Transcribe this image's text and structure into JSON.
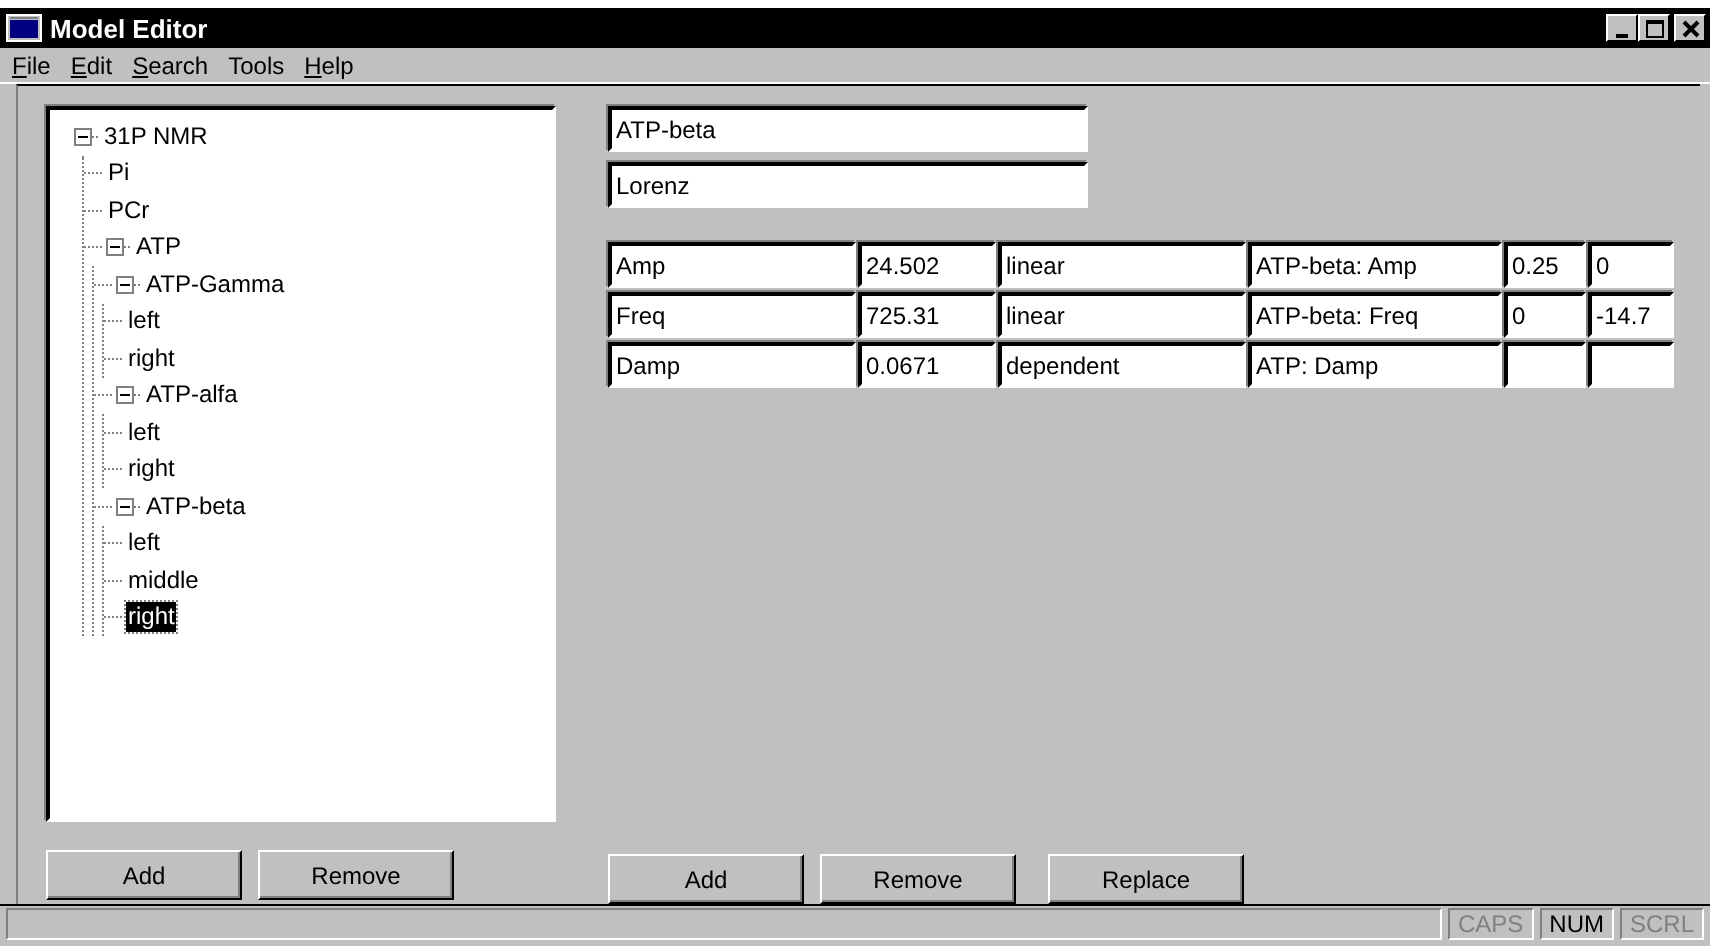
{
  "window": {
    "title": "Model Editor"
  },
  "menu": [
    {
      "label": "File",
      "underlined": true
    },
    {
      "label": "Edit",
      "underlined": true
    },
    {
      "label": "Search",
      "underlined": true
    },
    {
      "label": "Tools",
      "underlined": false
    },
    {
      "label": "Help",
      "underlined": true
    }
  ],
  "tree": [
    {
      "label": "31P NMR",
      "expanded": true,
      "selected": false,
      "children": [
        {
          "label": "Pi",
          "selected": false
        },
        {
          "label": "PCr",
          "selected": false
        },
        {
          "label": "ATP",
          "expanded": true,
          "selected": false,
          "children": [
            {
              "label": "ATP-Gamma",
              "expanded": true,
              "selected": false,
              "children": [
                {
                  "label": "left",
                  "selected": false
                },
                {
                  "label": "right",
                  "selected": false
                }
              ]
            },
            {
              "label": "ATP-alfa",
              "expanded": true,
              "selected": false,
              "children": [
                {
                  "label": "left",
                  "selected": false
                },
                {
                  "label": "right",
                  "selected": false
                }
              ]
            },
            {
              "label": "ATP-beta",
              "expanded": true,
              "selected": false,
              "children": [
                {
                  "label": "left",
                  "selected": false
                },
                {
                  "label": "middle",
                  "selected": false
                },
                {
                  "label": "right",
                  "selected": true
                }
              ]
            }
          ]
        }
      ]
    }
  ],
  "tree_buttons": [
    "Add",
    "Remove"
  ],
  "name_field": {
    "value": "ATP-beta"
  },
  "shape_field": {
    "value": "Lorenz"
  },
  "parameters": [
    {
      "column_1": "Amp",
      "column_2": "24.502",
      "column_3": "linear",
      "column_4": "ATP-beta: Amp",
      "column_5": "0.25",
      "column_6": "0"
    },
    {
      "column_1": "Freq",
      "column_2": "725.31",
      "column_3": "linear",
      "column_4": "ATP-beta: Freq",
      "column_5": "0",
      "column_6": "-14.7"
    },
    {
      "column_1": "Damp",
      "column_2": "0.0671",
      "column_3": "dependent",
      "column_4": "ATP: Damp"
    }
  ],
  "parameter_buttons": [
    "Add",
    "Remove",
    "Replace"
  ],
  "status_indicators": [
    {
      "label": "CAPS",
      "on": false
    },
    {
      "label": "NUM",
      "on": true
    },
    {
      "label": "SCRL",
      "on": false
    }
  ]
}
